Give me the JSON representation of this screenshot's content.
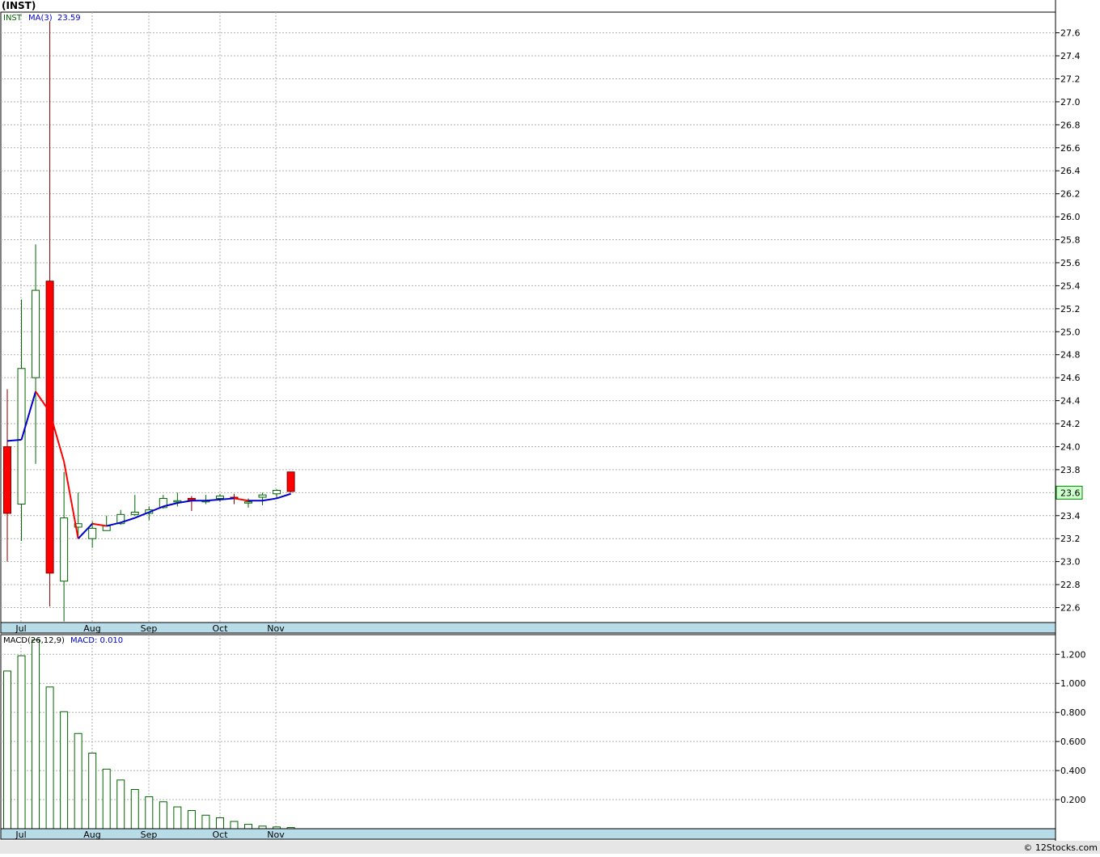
{
  "chart_data": [
    {
      "type": "candlestick",
      "title": "(INST)",
      "legend": {
        "symbol": "INST",
        "indicator": "MA(3)",
        "indicator_value": "23.59"
      },
      "current_price_label": "23.6",
      "ylim": [
        22.47,
        27.78
      ],
      "y_ticks": [
        "22.6",
        "22.8",
        "23.0",
        "23.2",
        "23.4",
        "23.6",
        "23.8",
        "24.0",
        "24.2",
        "24.4",
        "24.6",
        "24.8",
        "25.0",
        "25.2",
        "25.4",
        "25.6",
        "25.8",
        "26.0",
        "26.2",
        "26.4",
        "26.6",
        "26.8",
        "27.0",
        "27.2",
        "27.4",
        "27.6"
      ],
      "x_ticks": [
        "Jul",
        "Aug",
        "Sep",
        "Oct",
        "Nov"
      ],
      "candles": [
        {
          "o": 24.0,
          "h": 24.5,
          "l": 23.0,
          "c": 23.42
        },
        {
          "o": 23.5,
          "h": 25.28,
          "l": 23.18,
          "c": 24.68
        },
        {
          "o": 24.6,
          "h": 25.76,
          "l": 23.85,
          "c": 25.36
        },
        {
          "o": 25.44,
          "h": 27.7,
          "l": 22.61,
          "c": 22.9
        },
        {
          "o": 22.83,
          "h": 23.78,
          "l": 22.48,
          "c": 23.38
        },
        {
          "o": 23.3,
          "h": 23.6,
          "l": 23.2,
          "c": 23.33
        },
        {
          "o": 23.2,
          "h": 23.35,
          "l": 23.12,
          "c": 23.29
        },
        {
          "o": 23.27,
          "h": 23.4,
          "l": 23.27,
          "c": 23.31
        },
        {
          "o": 23.33,
          "h": 23.45,
          "l": 23.32,
          "c": 23.41
        },
        {
          "o": 23.41,
          "h": 23.58,
          "l": 23.4,
          "c": 23.43
        },
        {
          "o": 23.42,
          "h": 23.48,
          "l": 23.36,
          "c": 23.45
        },
        {
          "o": 23.47,
          "h": 23.58,
          "l": 23.46,
          "c": 23.55
        },
        {
          "o": 23.52,
          "h": 23.6,
          "l": 23.48,
          "c": 23.53
        },
        {
          "o": 23.55,
          "h": 23.57,
          "l": 23.44,
          "c": 23.53
        },
        {
          "o": 23.52,
          "h": 23.58,
          "l": 23.5,
          "c": 23.53
        },
        {
          "o": 23.55,
          "h": 23.59,
          "l": 23.52,
          "c": 23.57
        },
        {
          "o": 23.56,
          "h": 23.59,
          "l": 23.5,
          "c": 23.55
        },
        {
          "o": 23.52,
          "h": 23.55,
          "l": 23.47,
          "c": 23.52
        },
        {
          "o": 23.56,
          "h": 23.6,
          "l": 23.49,
          "c": 23.58
        },
        {
          "o": 23.59,
          "h": 23.63,
          "l": 23.55,
          "c": 23.62
        },
        {
          "o": 23.78,
          "h": 23.78,
          "l": 23.6,
          "c": 23.61
        }
      ],
      "ma3": [
        24.05,
        24.06,
        24.48,
        24.3,
        23.87,
        23.2,
        23.33,
        23.31,
        23.34,
        23.38,
        23.43,
        23.48,
        23.51,
        23.53,
        23.53,
        23.54,
        23.55,
        23.53,
        23.53,
        23.55,
        23.59
      ]
    },
    {
      "type": "bar",
      "title": "MACD(26,12,9)",
      "value_label": "MACD: 0.010",
      "ylim": [
        0.0,
        1.335
      ],
      "y_ticks": [
        "0.200",
        "0.400",
        "0.600",
        "0.800",
        "1.000",
        "1.200"
      ],
      "x_ticks": [
        "Jul",
        "Aug",
        "Sep",
        "Oct",
        "Nov"
      ],
      "values": [
        1.085,
        1.19,
        1.3,
        0.975,
        0.805,
        0.655,
        0.52,
        0.41,
        0.335,
        0.27,
        0.22,
        0.185,
        0.15,
        0.125,
        0.093,
        0.075,
        0.05,
        0.03,
        0.018,
        0.012,
        0.008
      ]
    }
  ],
  "colors": {
    "up_candle": "#ffffff",
    "up_outline": "#006400",
    "down_candle": "#ff0000",
    "ma_rising": "#0000cc",
    "ma_falling": "#ff0000",
    "axis_bar": "#b7dce8",
    "grid": "#b0b0b0",
    "price_box": "#ccffcc"
  },
  "footer": {
    "copyright": "© 12Stocks.com"
  }
}
